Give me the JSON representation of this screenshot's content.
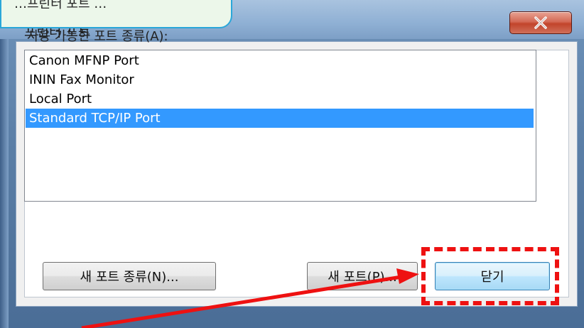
{
  "window": {
    "title": "프린터 포트",
    "close_label": "X"
  },
  "callout": {
    "text": "…프린터 포트 …"
  },
  "port_types": {
    "label": "사용 가능한 포트 종류(A):",
    "items": [
      {
        "label": "Canon MFNP Port",
        "selected": false
      },
      {
        "label": "ININ Fax Monitor",
        "selected": false
      },
      {
        "label": "Local Port",
        "selected": false
      },
      {
        "label": "Standard TCP/IP Port",
        "selected": true
      }
    ]
  },
  "buttons": {
    "new_port_type": "새 포트 종류(N)...",
    "new_port": "새 포트(P)...",
    "close": "닫기"
  },
  "colors": {
    "selection": "#3399ff",
    "annotation_red": "#ee1111",
    "callout_border": "#2aa7d9"
  }
}
